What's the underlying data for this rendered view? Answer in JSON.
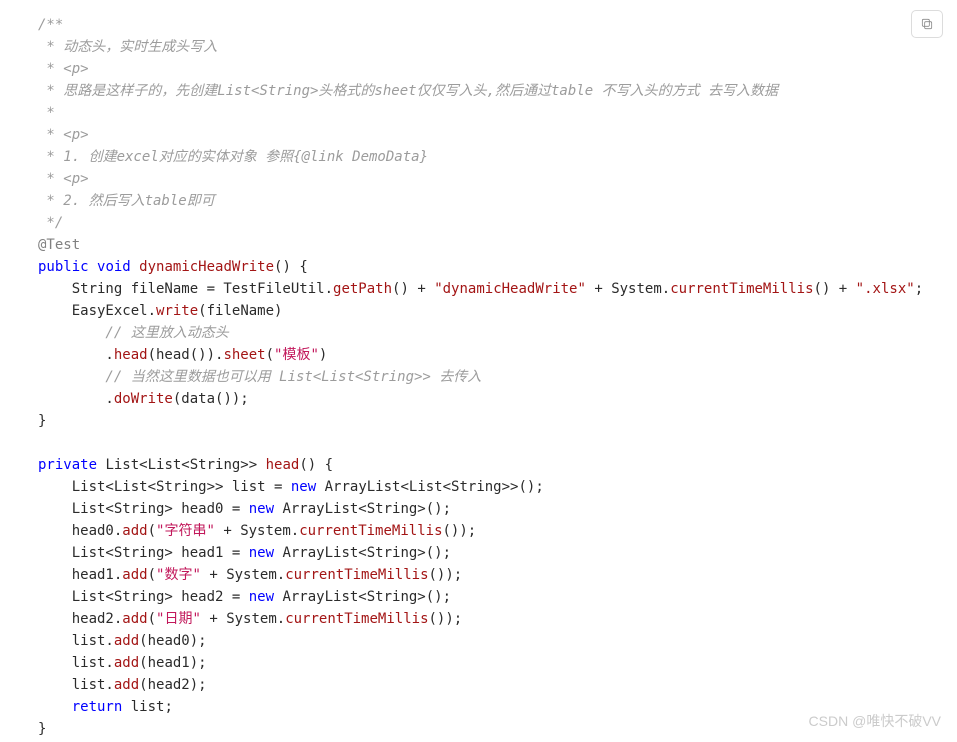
{
  "watermark": "CSDN @唯快不破VV",
  "copy_button": {
    "title": "复制"
  },
  "code": {
    "javadoc": {
      "line1": "/**",
      "line2": " * 动态头，实时生成头写入",
      "line3": " * <p>",
      "line4": " * 思路是这样子的，先创建List<String>头格式的sheet仅仅写入头,然后通过table 不写入头的方式 去写入数据",
      "line5": " *",
      "line6": " * <p>",
      "line7": " * 1. 创建excel对应的实体对象 参照{@link DemoData}",
      "line8": " * <p>",
      "line9": " * 2. 然后写入table即可",
      "line10": " */"
    },
    "ann_test": "@Test",
    "kw_public": "public",
    "kw_void": "void",
    "kw_private": "private",
    "kw_new": "new",
    "kw_return": "return",
    "m_dynamicHeadWrite": "dynamicHeadWrite",
    "m_head": "head",
    "line_fileName_a": "    String fileName = TestFileUtil.",
    "m_getPath": "getPath",
    "plus": " + ",
    "str_dynamicHeadWrite": "\"dynamicHeadWrite\"",
    "sys_ctm": "System.",
    "m_ctm": "currentTimeMillis",
    "str_xlsx": "\".xlsx\"",
    "easyexcel_write_a": "    EasyExcel.",
    "m_write": "write",
    "p_fileName": "(fileName)",
    "cmt_l1": "        // 这里放入动态头",
    "dot": "        .",
    "m_head_call": "head",
    "args_headcall": "(head()).",
    "m_sheet": "sheet",
    "str_template": "\"模板\"",
    "cmt_l2": "        // 当然这里数据也可以用 List<List<String>> 去传入",
    "m_doWrite": "doWrite",
    "args_data": "(data());",
    "closeBrace": "}",
    "head_sig_a": " List<List<String>> ",
    "head_sig_b": "() {",
    "line_listdecl_a": "    List<List<String>> list = ",
    "ArrayListLL": " ArrayList<List<String>>();",
    "line_head0_a": "    List<String> head0 = ",
    "ArrayListS": " ArrayList<String>();",
    "head0_add_a": "    head0.",
    "m_add": "add",
    "open_paren": "(",
    "str_zifu": "\"字符串\"",
    "close_ctm": "());",
    "line_head1_a": "    List<String> head1 = ",
    "head1_add_a": "    head1.",
    "str_shuzi": "\"数字\"",
    "line_head2_a": "    List<String> head2 = ",
    "head2_add_a": "    head2.",
    "str_riqi": "\"日期\"",
    "list_add_a": "    list.",
    "args_head0": "(head0);",
    "args_head1": "(head1);",
    "args_head2": "(head2);",
    "ret_list": " list;"
  }
}
